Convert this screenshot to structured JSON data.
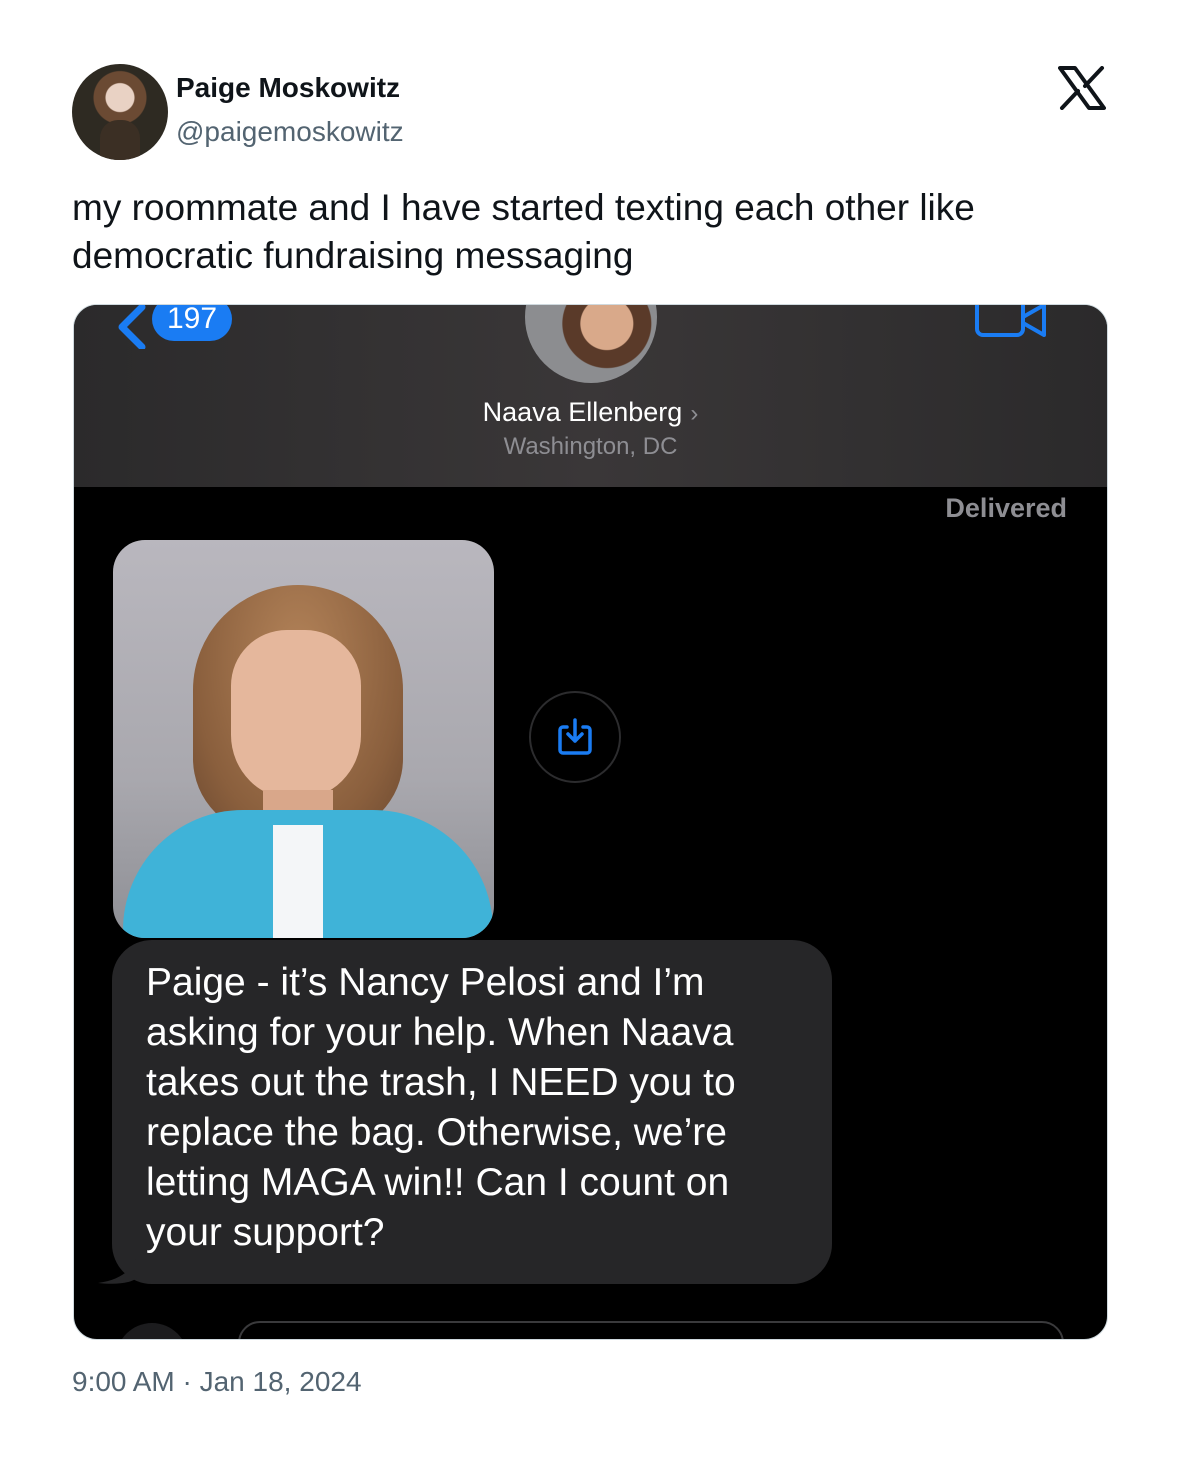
{
  "author": {
    "name": "Paige Moskowitz",
    "handle": "@paigemoskowitz"
  },
  "tweet": {
    "text": "my roommate and I have started texting each other like democratic fundraising messaging",
    "date": "9:00 AM · Jan 18, 2024"
  },
  "screenshot": {
    "back_count": "197",
    "contact_name": "Naava Ellenberg",
    "contact_location": "Washington, DC",
    "status": "Delivered",
    "message": "Paige - it’s Nancy Pelosi and I’m asking for your help. When Naava takes out the trash, I NEED you to replace the bag. Otherwise, we’re letting MAGA win!! Can I count on your support?",
    "accent_color": "#1a7cf3"
  },
  "icons": {
    "logo": "x-logo-icon",
    "back": "chevron-left-icon",
    "video": "video-camera-icon",
    "save": "save-download-icon"
  }
}
